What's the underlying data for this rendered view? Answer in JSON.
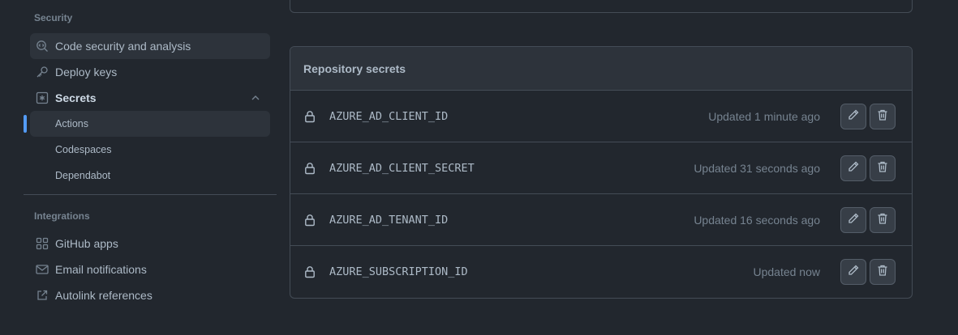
{
  "sidebar": {
    "security_label": "Security",
    "items": [
      {
        "label": "Code security and analysis",
        "icon": "codescan-icon"
      },
      {
        "label": "Deploy keys",
        "icon": "key-icon"
      },
      {
        "label": "Secrets",
        "icon": "asterisk-box-icon"
      }
    ],
    "secrets_sub": [
      {
        "label": "Actions"
      },
      {
        "label": "Codespaces"
      },
      {
        "label": "Dependabot"
      }
    ],
    "integrations_label": "Integrations",
    "integrations": [
      {
        "label": "GitHub apps",
        "icon": "apps-icon"
      },
      {
        "label": "Email notifications",
        "icon": "mail-icon"
      },
      {
        "label": "Autolink references",
        "icon": "link-external-icon"
      }
    ]
  },
  "secrets_panel": {
    "title": "Repository secrets",
    "rows": [
      {
        "name": "AZURE_AD_CLIENT_ID",
        "updated": "Updated 1 minute ago"
      },
      {
        "name": "AZURE_AD_CLIENT_SECRET",
        "updated": "Updated 31 seconds ago"
      },
      {
        "name": "AZURE_AD_TENANT_ID",
        "updated": "Updated 16 seconds ago"
      },
      {
        "name": "AZURE_SUBSCRIPTION_ID",
        "updated": "Updated now"
      }
    ]
  },
  "colors": {
    "background": "#22272e",
    "accent": "#539bf5",
    "border": "#444c56"
  }
}
